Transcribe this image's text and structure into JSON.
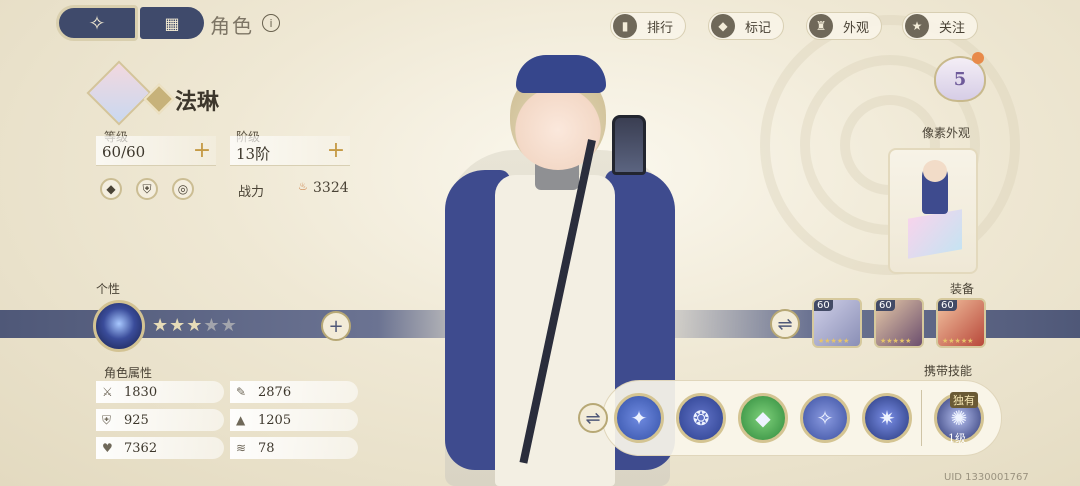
{
  "nav": {
    "back_symbol": "✧",
    "grid_symbol": "▦",
    "title": "角色",
    "info_symbol": "i"
  },
  "top_actions": [
    {
      "label": "排行",
      "icon": "ranking-icon",
      "glyph": "▮"
    },
    {
      "label": "标记",
      "icon": "tag-icon",
      "glyph": "◆"
    },
    {
      "label": "外观",
      "icon": "outfit-icon",
      "glyph": "♜"
    },
    {
      "label": "关注",
      "icon": "star-icon",
      "glyph": "★"
    }
  ],
  "character": {
    "name": "法琳",
    "level_label": "等级",
    "level_value": "60/60",
    "rank_label": "阶级",
    "rank_value": "13阶",
    "power_label": "战力",
    "power_value": "3324",
    "badge_level": "5"
  },
  "persona": {
    "label": "个性",
    "stars_filled": 3,
    "stars_total": 5
  },
  "attributes": {
    "label": "角色属性",
    "items": [
      {
        "icon": "sword-icon",
        "glyph": "⚔",
        "value": "1830"
      },
      {
        "icon": "magic-icon",
        "glyph": "✎",
        "value": "2876"
      },
      {
        "icon": "shield-icon",
        "glyph": "⛨",
        "value": "925"
      },
      {
        "icon": "hat-icon",
        "glyph": "▲",
        "value": "1205"
      },
      {
        "icon": "heart-icon",
        "glyph": "♥",
        "value": "7362"
      },
      {
        "icon": "wing-icon",
        "glyph": "≋",
        "value": "78"
      }
    ]
  },
  "pixel_look": {
    "label": "像素外观"
  },
  "equipment": {
    "label": "装备",
    "items": [
      {
        "level": "60",
        "color_a": "#cfcfe8",
        "color_b": "#8a8fb6"
      },
      {
        "level": "60",
        "color_a": "#e6c9a8",
        "color_b": "#6c4f6e"
      },
      {
        "level": "60",
        "color_a": "#f2c2a0",
        "color_b": "#b8483a"
      }
    ]
  },
  "skills": {
    "label": "携带技能",
    "unique_tag": "独有",
    "unique_level": "1级",
    "items": [
      {
        "glyph": "✦",
        "color": "#3552a8"
      },
      {
        "glyph": "❂",
        "color": "#2b3f8e"
      },
      {
        "glyph": "◆",
        "color": "#2f8a3c"
      },
      {
        "glyph": "✧",
        "color": "#3a4fa0"
      },
      {
        "glyph": "✷",
        "color": "#27387c"
      }
    ]
  },
  "uid": "UID 1330001767",
  "colors": {
    "navy": "#3f4a6b",
    "gold": "#c59a45",
    "cream": "#f3ecd8"
  }
}
